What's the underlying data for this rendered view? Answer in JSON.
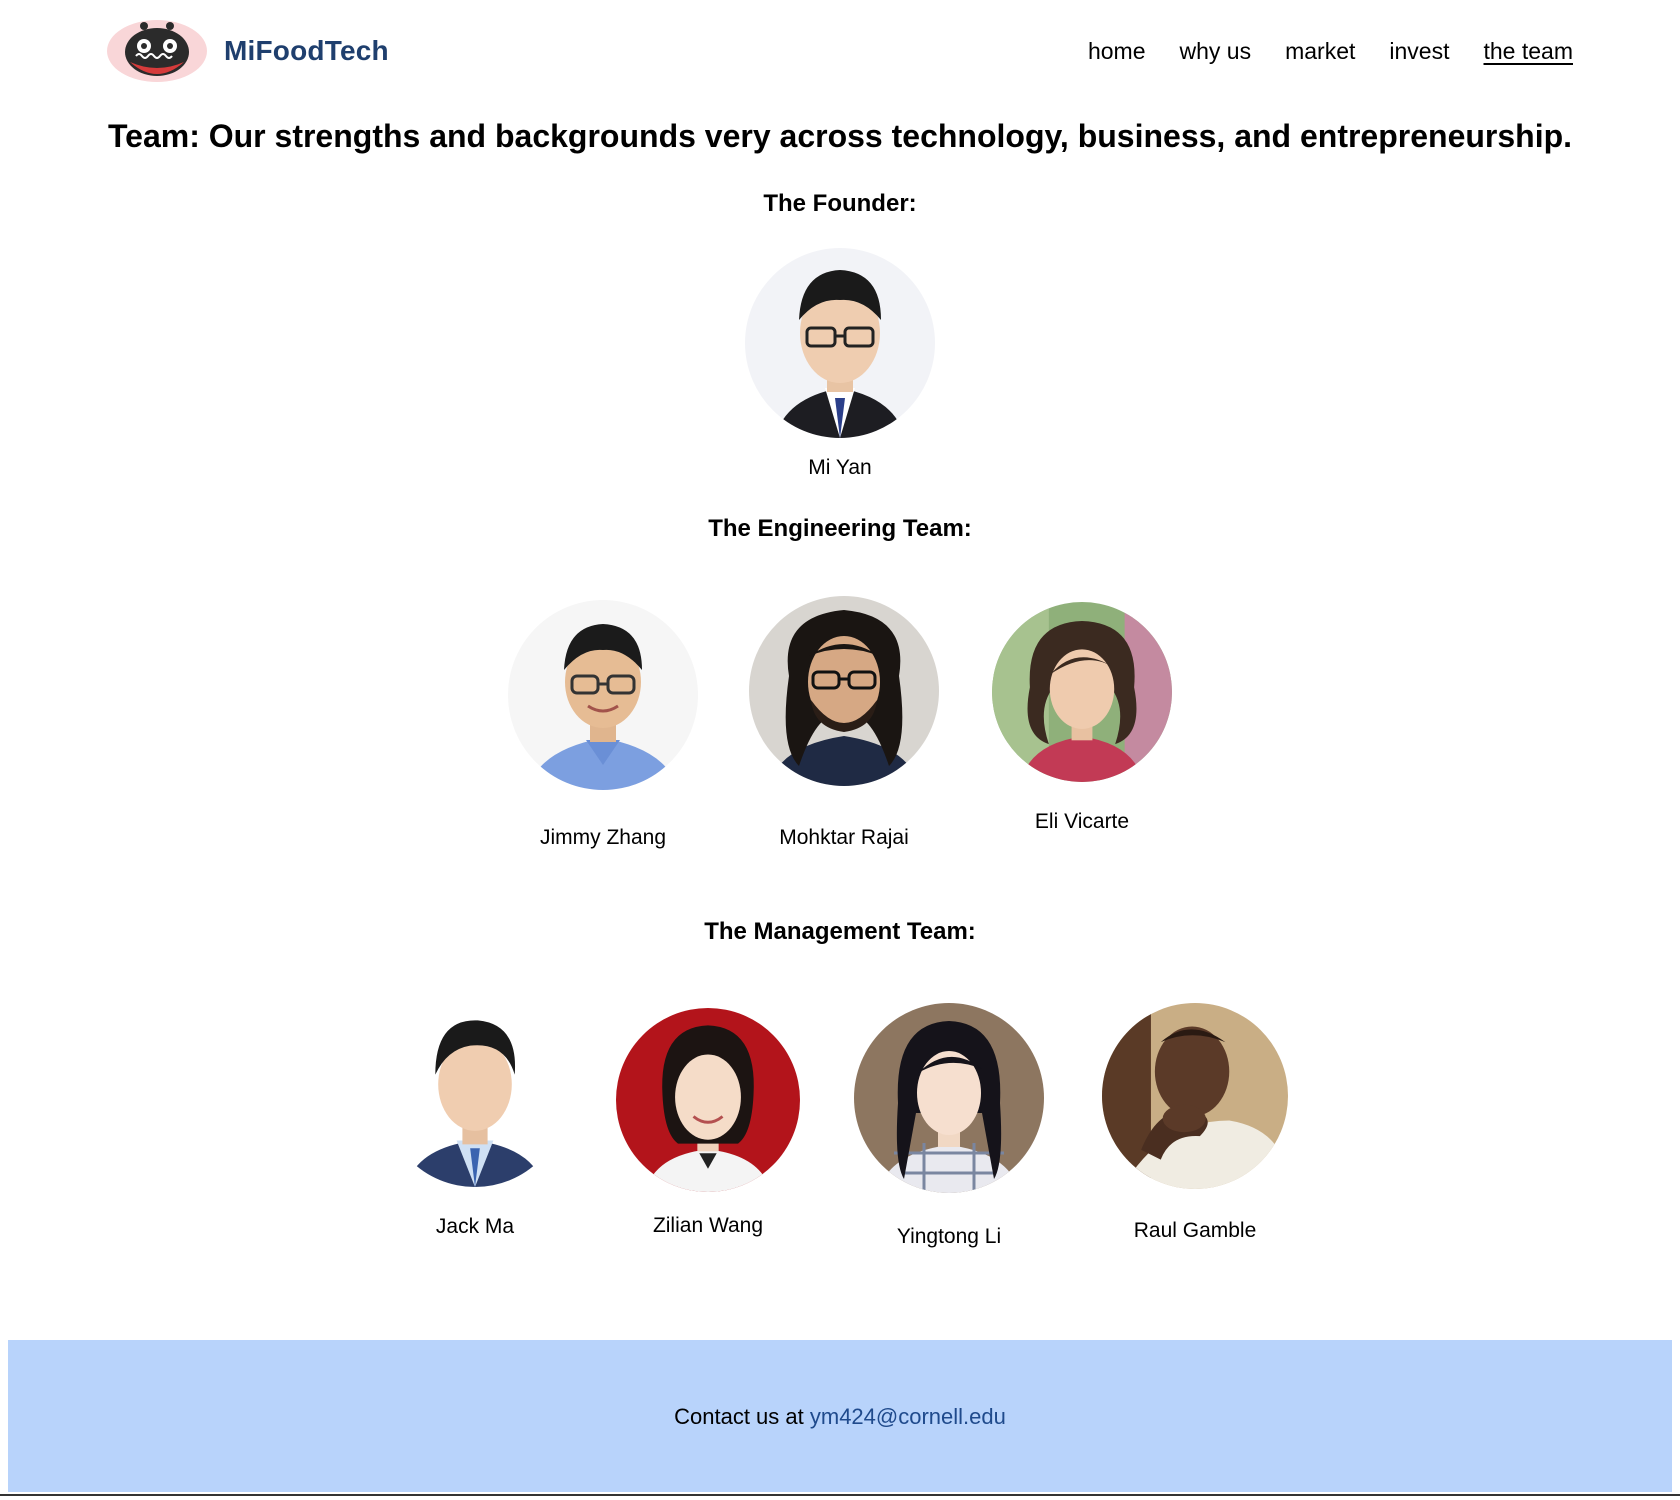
{
  "header": {
    "brand_name": "MiFoodTech",
    "nav": [
      "home",
      "why us",
      "market",
      "invest",
      "the team"
    ],
    "active_nav": "the team"
  },
  "headline": "Team: Our strengths and backgrounds very across technology, business, and entrepreneurship.",
  "sections": {
    "founder": {
      "title": "The Founder:",
      "members": [
        "Mi Yan"
      ]
    },
    "engineering": {
      "title": "The Engineering Team:",
      "members": [
        "Jimmy Zhang",
        "Mohktar Rajai",
        "Eli Vicarte"
      ]
    },
    "management": {
      "title": "The Management Team:",
      "members": [
        "Jack Ma",
        "Zilian Wang",
        "Yingtong Li",
        "Raul Gamble"
      ]
    }
  },
  "footer": {
    "contact_prefix": "Contact us at ",
    "email": "ym424@cornell.edu"
  },
  "colors": {
    "brand": "#1f3f6e",
    "footer_bg": "#b8d3fb",
    "link": "#1f4a8c"
  }
}
